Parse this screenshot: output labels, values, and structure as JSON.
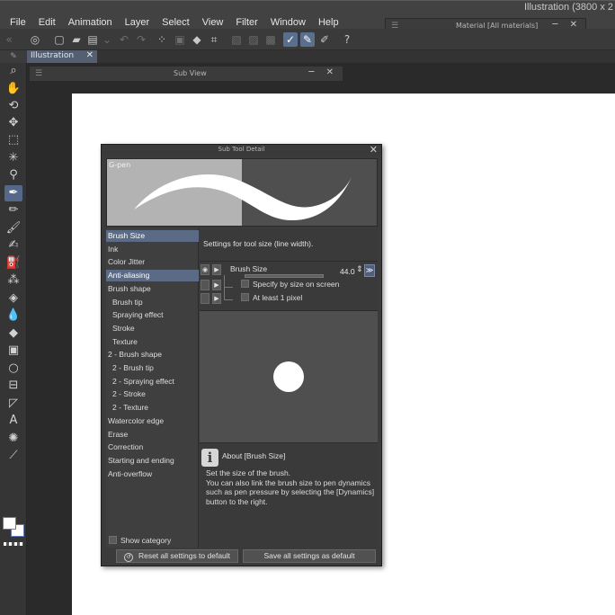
{
  "app": {
    "title": "Illustration (3800 x 2",
    "menus": [
      "File",
      "Edit",
      "Animation",
      "Layer",
      "Select",
      "View",
      "Filter",
      "Window",
      "Help"
    ]
  },
  "material_window": {
    "title": "Material [All materials]"
  },
  "document_tab": {
    "label": "Illustration"
  },
  "sub_view": {
    "title": "Sub View"
  },
  "toolbar_icons": [
    "zoom-icon",
    "hand-icon",
    "rotate-icon",
    "move-icon",
    "selection-icon",
    "auto-select-icon",
    "eyedropper-icon",
    "pen-icon",
    "pencil-icon",
    "brush-icon",
    "marker-icon",
    "airbrush-icon",
    "decoration-icon",
    "eraser-icon",
    "blend-icon",
    "fill-icon",
    "gradient-icon",
    "figure-icon",
    "frame-border-icon",
    "ruler-icon",
    "text-icon",
    "balloon-icon",
    "correct-line-icon"
  ],
  "sub_tool_detail": {
    "title": "Sub Tool Detail",
    "preview_label": "G-pen",
    "categories": [
      {
        "label": "Brush Size",
        "indent": false,
        "selected": true
      },
      {
        "label": "Ink",
        "indent": false,
        "selected": false
      },
      {
        "label": "Color Jitter",
        "indent": false,
        "selected": false
      },
      {
        "label": "Anti-aliasing",
        "indent": false,
        "selected": true
      },
      {
        "label": "Brush shape",
        "indent": false,
        "selected": false
      },
      {
        "label": "Brush tip",
        "indent": true,
        "selected": false
      },
      {
        "label": "Spraying effect",
        "indent": true,
        "selected": false
      },
      {
        "label": "Stroke",
        "indent": true,
        "selected": false
      },
      {
        "label": "Texture",
        "indent": true,
        "selected": false
      },
      {
        "label": "2 - Brush shape",
        "indent": false,
        "selected": false
      },
      {
        "label": "2 - Brush tip",
        "indent": true,
        "selected": false
      },
      {
        "label": "2 - Spraying effect",
        "indent": true,
        "selected": false
      },
      {
        "label": "2 - Stroke",
        "indent": true,
        "selected": false
      },
      {
        "label": "2 - Texture",
        "indent": true,
        "selected": false
      },
      {
        "label": "Watercolor edge",
        "indent": false,
        "selected": false
      },
      {
        "label": "Erase",
        "indent": false,
        "selected": false
      },
      {
        "label": "Correction",
        "indent": false,
        "selected": false
      },
      {
        "label": "Starting and ending",
        "indent": false,
        "selected": false
      },
      {
        "label": "Anti-overflow",
        "indent": false,
        "selected": false
      }
    ],
    "show_category_label": "Show category",
    "settings_description": "Settings for tool size (line width).",
    "brush_size": {
      "label": "Brush Size",
      "value": "44.0"
    },
    "option_specify": "Specify by size on screen",
    "option_min": "At least 1 pixel",
    "about": {
      "title": "About [Brush Size]",
      "lines": [
        "Set the size of the brush.",
        "You can also link the brush size to pen dynamics",
        "such as pen pressure by selecting the [Dynamics]",
        "button to the right."
      ]
    },
    "reset_button": "Reset all settings to default",
    "save_button": "Save all settings as default"
  }
}
